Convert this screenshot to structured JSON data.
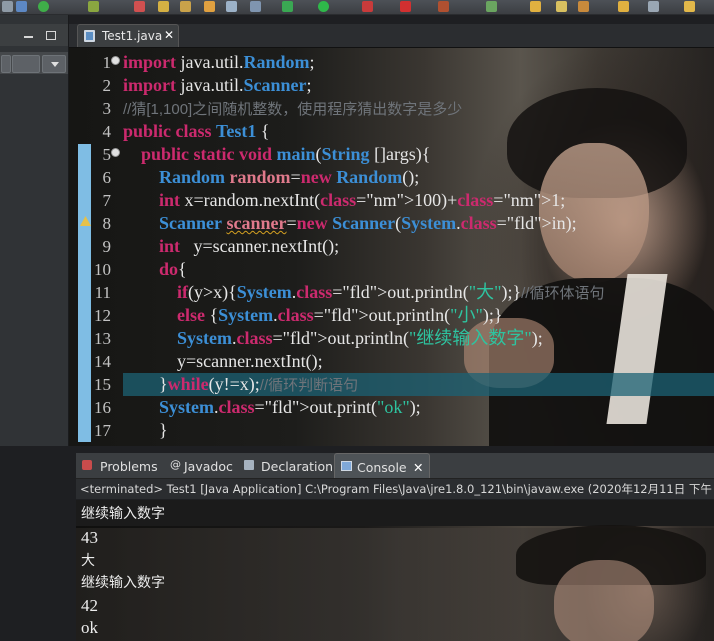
{
  "toolbar": {
    "icons": [
      "new-icon",
      "save-icon",
      "debug-icon",
      "run-icon",
      "external-tools-icon",
      "new-java-project-icon",
      "new-package-icon",
      "new-class-icon",
      "open-type-icon",
      "search-icon",
      "next-annotation-icon",
      "prev-annotation-icon",
      "back-icon",
      "forward-icon"
    ]
  },
  "left_panel": {
    "icons": [
      "minimize-icon",
      "maximize-icon",
      "collapse-all-icon",
      "link-editor-icon",
      "view-menu-icon"
    ]
  },
  "editor": {
    "tab_label": "Test1.java",
    "tab_close": "✕",
    "lines": [
      {
        "n": "1",
        "text": "import java.util.Random;"
      },
      {
        "n": "2",
        "text": "import java.util.Scanner;"
      },
      {
        "n": "3",
        "text": "//猜[1,100]之间随机整数，使用程序猜出数字是多少"
      },
      {
        "n": "4",
        "text": "public class Test1 {"
      },
      {
        "n": "5",
        "text": "    public static void main(String []args){"
      },
      {
        "n": "6",
        "text": "        Random random=new Random();"
      },
      {
        "n": "7",
        "text": "        int x=random.nextInt(100)+1;"
      },
      {
        "n": "8",
        "text": "        Scanner scanner=new Scanner(System.in);"
      },
      {
        "n": "9",
        "text": "        int   y=scanner.nextInt();"
      },
      {
        "n": "10",
        "text": "        do{"
      },
      {
        "n": "11",
        "text": "            if(y>x){System.out.println(\"大\");}//循环体语句"
      },
      {
        "n": "12",
        "text": "            else {System.out.println(\"小\");}"
      },
      {
        "n": "13",
        "text": "            System.out.println(\"继续输入数字\");"
      },
      {
        "n": "14",
        "text": "            y=scanner.nextInt();"
      },
      {
        "n": "15",
        "text": "        }while(y!=x);//循环判断语句"
      },
      {
        "n": "16",
        "text": "        System.out.print(\"ok\");"
      },
      {
        "n": "17",
        "text": "        }"
      }
    ]
  },
  "console": {
    "tabs": [
      {
        "label": "Problems",
        "icon": "problems-icon",
        "active": false
      },
      {
        "label": "Javadoc",
        "icon": "javadoc-icon",
        "active": false
      },
      {
        "label": "Declaration",
        "icon": "declaration-icon",
        "active": false
      },
      {
        "label": "Console",
        "icon": "console-icon",
        "active": true,
        "close": "✕"
      }
    ],
    "status": "<terminated> Test1 [Java Application] C:\\Program Files\\Java\\jre1.8.0_121\\bin\\javaw.exe (2020年12月11日 下午",
    "output": [
      "继续输入数字",
      "43",
      "大",
      "继续输入数字",
      "42",
      "ok"
    ]
  },
  "colors": {
    "keyword": "#cc2a6e",
    "class": "#3c8fd6",
    "comment": "#6f747a",
    "string": "#2ec4a0",
    "current_line": "#1c6274",
    "ruler": "#7fbde4"
  }
}
